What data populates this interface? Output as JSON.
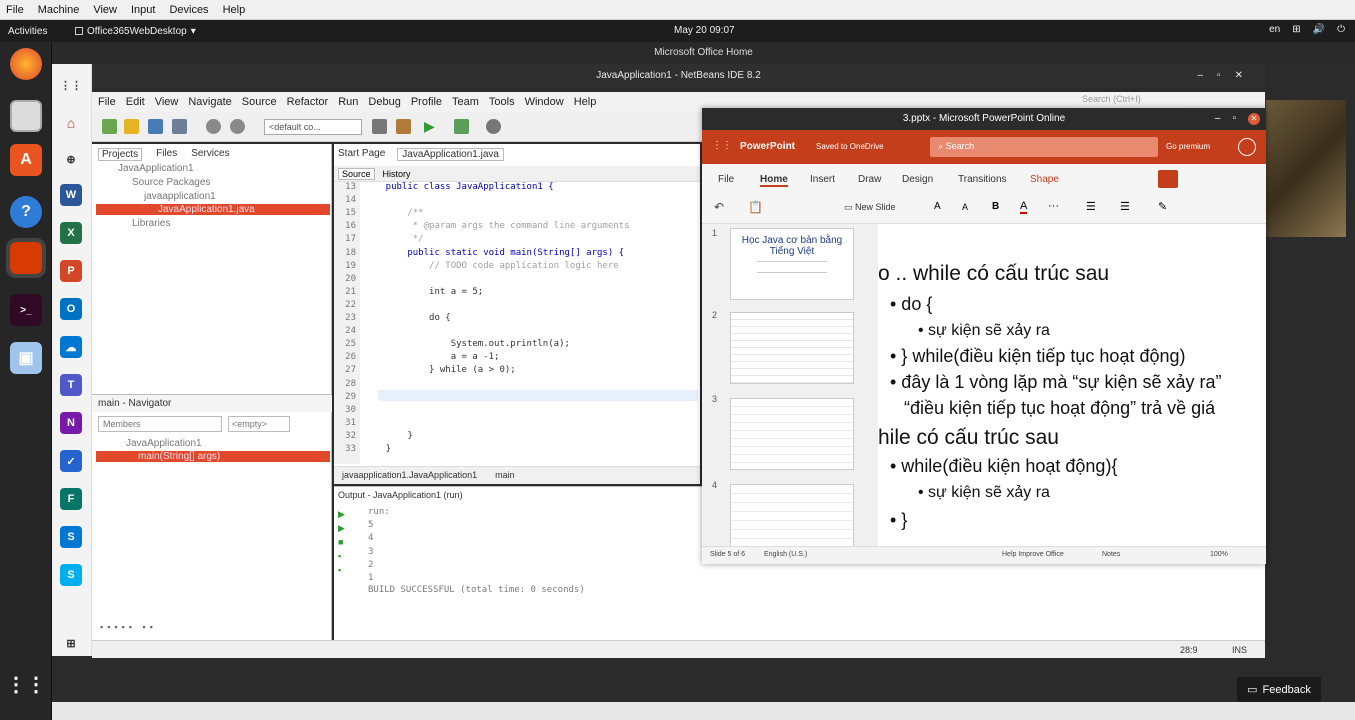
{
  "host_menu": [
    "File",
    "Machine",
    "View",
    "Input",
    "Devices",
    "Help"
  ],
  "topbar": {
    "activities": "Activities",
    "app_name": "Office365WebDesktop",
    "clock": "May 20  09:07",
    "lang": "en"
  },
  "office_window_title": "Microsoft Office Home",
  "netbeans": {
    "title": "JavaApplication1 - NetBeans IDE 8.2",
    "menu": [
      "File",
      "Edit",
      "View",
      "Navigate",
      "Source",
      "Refactor",
      "Run",
      "Debug",
      "Profile",
      "Team",
      "Tools",
      "Window",
      "Help"
    ],
    "config_combo": "<default co...",
    "search_placeholder": "Search (Ctrl+I)",
    "panel_tabs": [
      "Projects",
      "Files",
      "Services"
    ],
    "tree": [
      "JavaApplication1",
      "Source Packages",
      "javaapplication1",
      "JavaApplication1.java",
      "Libraries"
    ],
    "navigator_title": "main - Navigator",
    "navigator_filter": "Members",
    "navigator_empty": "<empty>",
    "nav_tree": [
      "JavaApplication1",
      "main(String[] args)"
    ],
    "editor_tabs": [
      "Start Page",
      "JavaApplication1.java"
    ],
    "editor_subtabs": [
      "Source",
      "History"
    ],
    "line_numbers": [
      "13",
      "14",
      "15",
      "16",
      "17",
      "18",
      "19",
      "20",
      "21",
      "22",
      "23",
      "24",
      "25",
      "26",
      "27",
      "28",
      "29",
      "30",
      "31",
      "32",
      "33"
    ],
    "code_lines": [
      {
        "t": "    public class JavaApplication1 {",
        "c": "kw"
      },
      {
        "t": "",
        "c": ""
      },
      {
        "t": "        /**",
        "c": "cm"
      },
      {
        "t": "         * @param args the command line arguments",
        "c": "cm"
      },
      {
        "t": "         */",
        "c": "cm"
      },
      {
        "t": "        public static void main(String[] args) {",
        "c": "kw"
      },
      {
        "t": "            // TODO code application logic here",
        "c": "cm"
      },
      {
        "t": "",
        "c": ""
      },
      {
        "t": "            int a = 5;",
        "c": ""
      },
      {
        "t": "",
        "c": ""
      },
      {
        "t": "            do {",
        "c": ""
      },
      {
        "t": "",
        "c": ""
      },
      {
        "t": "                System.out.println(a);",
        "c": ""
      },
      {
        "t": "                a = a -1;",
        "c": ""
      },
      {
        "t": "            } while (a > 0);",
        "c": ""
      },
      {
        "t": "",
        "c": ""
      },
      {
        "t": "",
        "c": ""
      },
      {
        "t": "",
        "c": ""
      },
      {
        "t": "",
        "c": ""
      },
      {
        "t": "        }",
        "c": ""
      },
      {
        "t": "    }",
        "c": ""
      }
    ],
    "breadcrumb": [
      "javaapplication1.JavaApplication1",
      "main"
    ],
    "output_title": "Output - JavaApplication1 (run)",
    "output_lines": [
      "run:",
      "5",
      "4",
      "3",
      "2",
      "1",
      "BUILD SUCCESSFUL (total time: 0 seconds)"
    ],
    "status_pos": "28:9",
    "status_mode": "INS"
  },
  "ppt": {
    "title": "3.pptx - Microsoft PowerPoint Online",
    "brand": "PowerPoint",
    "saved": "Saved to OneDrive",
    "search": "Search",
    "premium": "Go premium",
    "tabs": [
      "File",
      "Home",
      "Insert",
      "Draw",
      "Design",
      "Transitions",
      "Shape"
    ],
    "new_slide": "New Slide",
    "thumb_numbers": [
      "1",
      "2",
      "3",
      "4"
    ],
    "thumb1_title": "Học Java cơ bản bằng Tiếng Việt",
    "slide_lines": [
      {
        "t": "o .. while có cấu trúc sau",
        "lvl": 0
      },
      {
        "t": "• do {",
        "lvl": 1
      },
      {
        "t": "• sự kiện sẽ xảy ra",
        "lvl": 2
      },
      {
        "t": "• } while(điều kiện tiếp tục hoạt động)",
        "lvl": 1
      },
      {
        "t": "• đây là 1 vòng lặp mà “sự kiện sẽ xảy ra”",
        "lvl": 1
      },
      {
        "t": "“điều kiện tiếp tục hoạt động” trả về giá",
        "lvl": 3
      },
      {
        "t": "hile có cấu trúc sau",
        "lvl": 0
      },
      {
        "t": "• while(điều kiện hoạt động){",
        "lvl": 1
      },
      {
        "t": "• sự kiện sẽ xảy ra",
        "lvl": 2
      },
      {
        "t": "• }",
        "lvl": 1
      }
    ],
    "status_slide": "Slide 5 of 6",
    "status_lang": "English (U.S.)",
    "status_help": "Help Improve Office",
    "status_notes": "Notes",
    "status_zoom": "100%"
  },
  "feedback": "Feedback"
}
